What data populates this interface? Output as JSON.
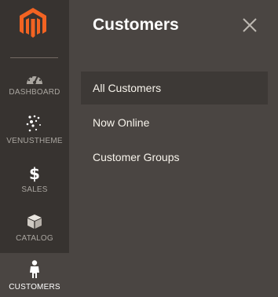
{
  "sidebar": {
    "logo": "magento-logo-icon",
    "items": [
      {
        "label": "DASHBOARD",
        "icon": "dashboard-icon"
      },
      {
        "label": "VENUSTHEME",
        "icon": "venustheme-icon"
      },
      {
        "label": "SALES",
        "icon": "dollar-icon"
      },
      {
        "label": "CATALOG",
        "icon": "box-icon"
      },
      {
        "label": "CUSTOMERS",
        "icon": "person-icon",
        "active": true
      }
    ]
  },
  "panel": {
    "title": "Customers",
    "close_icon": "close-icon",
    "items": [
      {
        "label": "All Customers",
        "selected": true
      },
      {
        "label": "Now Online"
      },
      {
        "label": "Customer Groups"
      }
    ]
  },
  "colors": {
    "brand": "#f26322",
    "sidebar_bg": "#373330",
    "panel_bg": "#4a4542",
    "selected_item_bg": "#3d3936",
    "sidebar_text": "#aaa6a0"
  }
}
